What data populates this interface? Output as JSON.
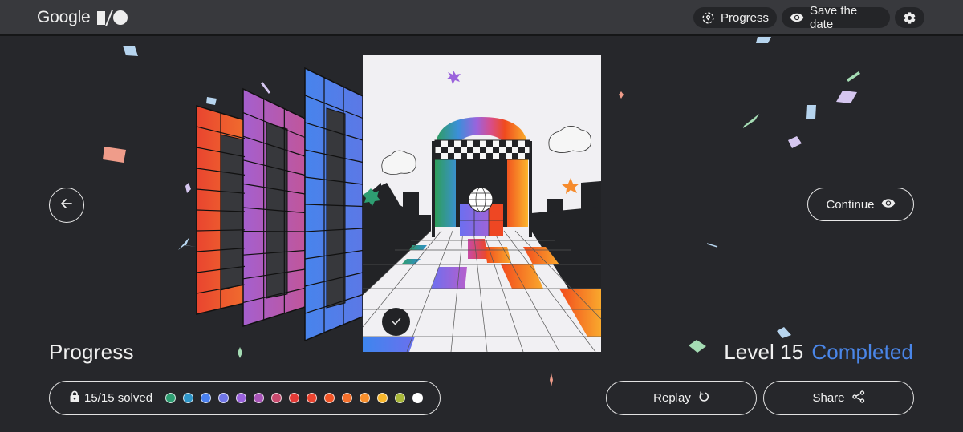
{
  "header": {
    "logo_text": "Google",
    "logo_mark": "I/O",
    "buttons": [
      {
        "label": "Progress",
        "icon": "location-pin-icon"
      },
      {
        "label": "Save the date",
        "icon": "eye-icon"
      },
      {
        "label": "",
        "icon": "gear-icon"
      }
    ]
  },
  "navigation": {
    "back_icon": "arrow-left-icon",
    "continue_label": "Continue",
    "continue_icon": "eye-icon"
  },
  "puzzle": {
    "stacked_panels": [
      {
        "color": "#e9452f",
        "accent": "#f06c2e"
      },
      {
        "color": "#a55fce",
        "accent": "#c0569b"
      },
      {
        "color": "#4784ec",
        "accent": "#5c78e6"
      }
    ],
    "completed_check_icon": "checkmark-icon"
  },
  "progress": {
    "title": "Progress",
    "solved_text": "15/15 solved",
    "lock_icon": "lock-icon",
    "solved_count": 15,
    "total": 15,
    "level_dots": [
      "#2e9e72",
      "#2f96c9",
      "#4a80f0",
      "#6f75e6",
      "#9a62dc",
      "#a955b8",
      "#c84a6e",
      "#e23a36",
      "#ec4430",
      "#f25426",
      "#f5702c",
      "#f88f2c",
      "#f9b72c",
      "#a9b83a",
      "#ffffff"
    ]
  },
  "level": {
    "label": "Level 15",
    "status": "Completed",
    "status_color": "#4a86e8"
  },
  "actions": {
    "replay_label": "Replay",
    "replay_icon": "refresh-icon",
    "share_label": "Share",
    "share_icon": "share-icon"
  }
}
